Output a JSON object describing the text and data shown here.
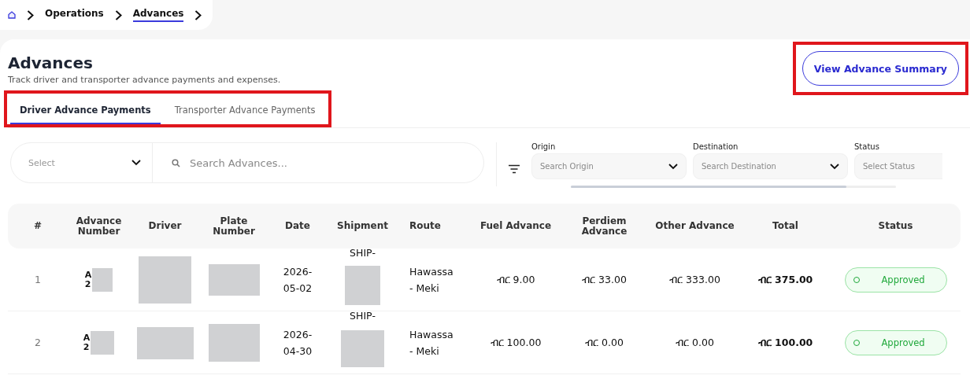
{
  "breadcrumb": {
    "items": [
      {
        "label": "Operations",
        "current": false
      },
      {
        "label": "Advances",
        "current": true
      }
    ]
  },
  "header": {
    "title": "Advances",
    "subtitle": "Track driver and transporter advance payments and expenses.",
    "summary_button": {
      "label": "View Advance Summary",
      "highlighted": true
    }
  },
  "tabs": {
    "highlighted": true,
    "items": [
      {
        "label": "Driver Advance Payments",
        "selected": true
      },
      {
        "label": "Transporter Advance Payments",
        "selected": false
      }
    ]
  },
  "search": {
    "select_placeholder": "Select",
    "placeholder": "Search Advances..."
  },
  "filters": [
    {
      "label": "Origin",
      "placeholder": "Search Origin"
    },
    {
      "label": "Destination",
      "placeholder": "Search Destination"
    },
    {
      "label": "Status",
      "placeholder": "Select Status"
    }
  ],
  "table": {
    "columns": [
      "#",
      "Advance Number",
      "Driver",
      "Plate Number",
      "Date",
      "Shipment",
      "Route",
      "Fuel Advance",
      "Perdiem Advance",
      "Other Advance",
      "Total",
      "Status"
    ],
    "rows": [
      {
        "index": "1",
        "advance_number": "A\n2",
        "date": "2026-\n05-02",
        "shipment": "SHIP-",
        "route": "Hawassa\n- Meki",
        "fuel": "ብር 9.00",
        "perdiem": "ብር 33.00",
        "other": "ብር 333.00",
        "total": "ብር 375.00",
        "status": "Approved"
      },
      {
        "index": "2",
        "advance_number": "A\n2",
        "date": "2026-\n04-30",
        "shipment": "SHIP-",
        "route": "Hawassa\n- Meki",
        "fuel": "ብር 100.00",
        "perdiem": "ብር 0.00",
        "other": "ብር 0.00",
        "total": "ብር 100.00",
        "status": "Approved"
      }
    ]
  }
}
